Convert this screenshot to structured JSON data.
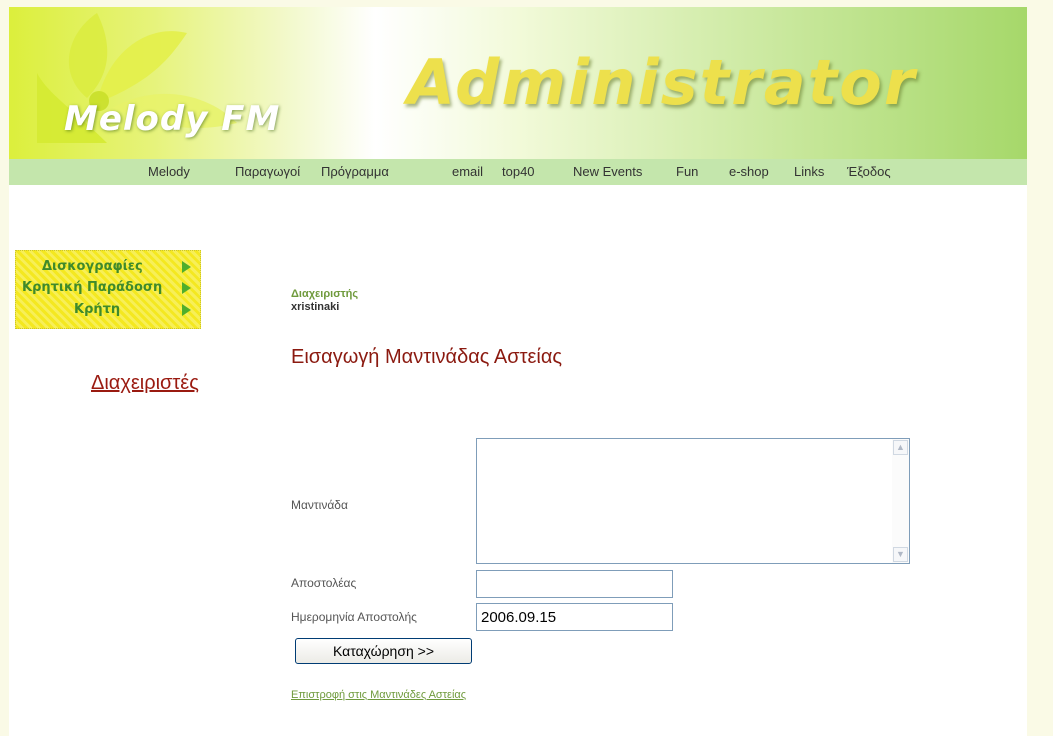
{
  "header": {
    "logo_text": "Melody FM",
    "title": "Administrator"
  },
  "nav": {
    "items": [
      {
        "label": "Melody"
      },
      {
        "label": "Παραγωγοί"
      },
      {
        "label": "Πρόγραμμα"
      },
      {
        "label": "email"
      },
      {
        "label": "top40"
      },
      {
        "label": "New Events"
      },
      {
        "label": "Fun"
      },
      {
        "label": "e-shop"
      },
      {
        "label": "Links"
      },
      {
        "label": "Έξοδος"
      }
    ]
  },
  "sidebar": {
    "menu": [
      {
        "label": "Δισκογραφίες"
      },
      {
        "label": "Κρητική Παράδοση"
      },
      {
        "label": "Κρήτη"
      }
    ],
    "admins_link": "Διαχειριστές"
  },
  "main": {
    "admin_role_label": "Διαχειριστής",
    "admin_username": "xristinaki",
    "page_title": "Εισαγωγή Μαντινάδας Αστείας",
    "form": {
      "mantinada_label": "Μαντινάδα",
      "mantinada_value": "",
      "sender_label": "Αποστολέας",
      "sender_value": "",
      "date_label": "Ημερομηνία Αποστολής",
      "date_value": "2006.09.15",
      "submit_label": "Καταχώρηση >>"
    },
    "back_link": "Επιστροφή στις Μαντινάδες Αστείας"
  },
  "colors": {
    "nav_background": "#c4e6ac",
    "title_red": "#8b1a10",
    "link_green": "#6f9a3c",
    "menu_yellow": "#f4e820"
  },
  "icons": {
    "menu_arrow": "play-arrow-icon",
    "scroll_up": "scroll-up-icon",
    "scroll_down": "scroll-down-icon"
  }
}
